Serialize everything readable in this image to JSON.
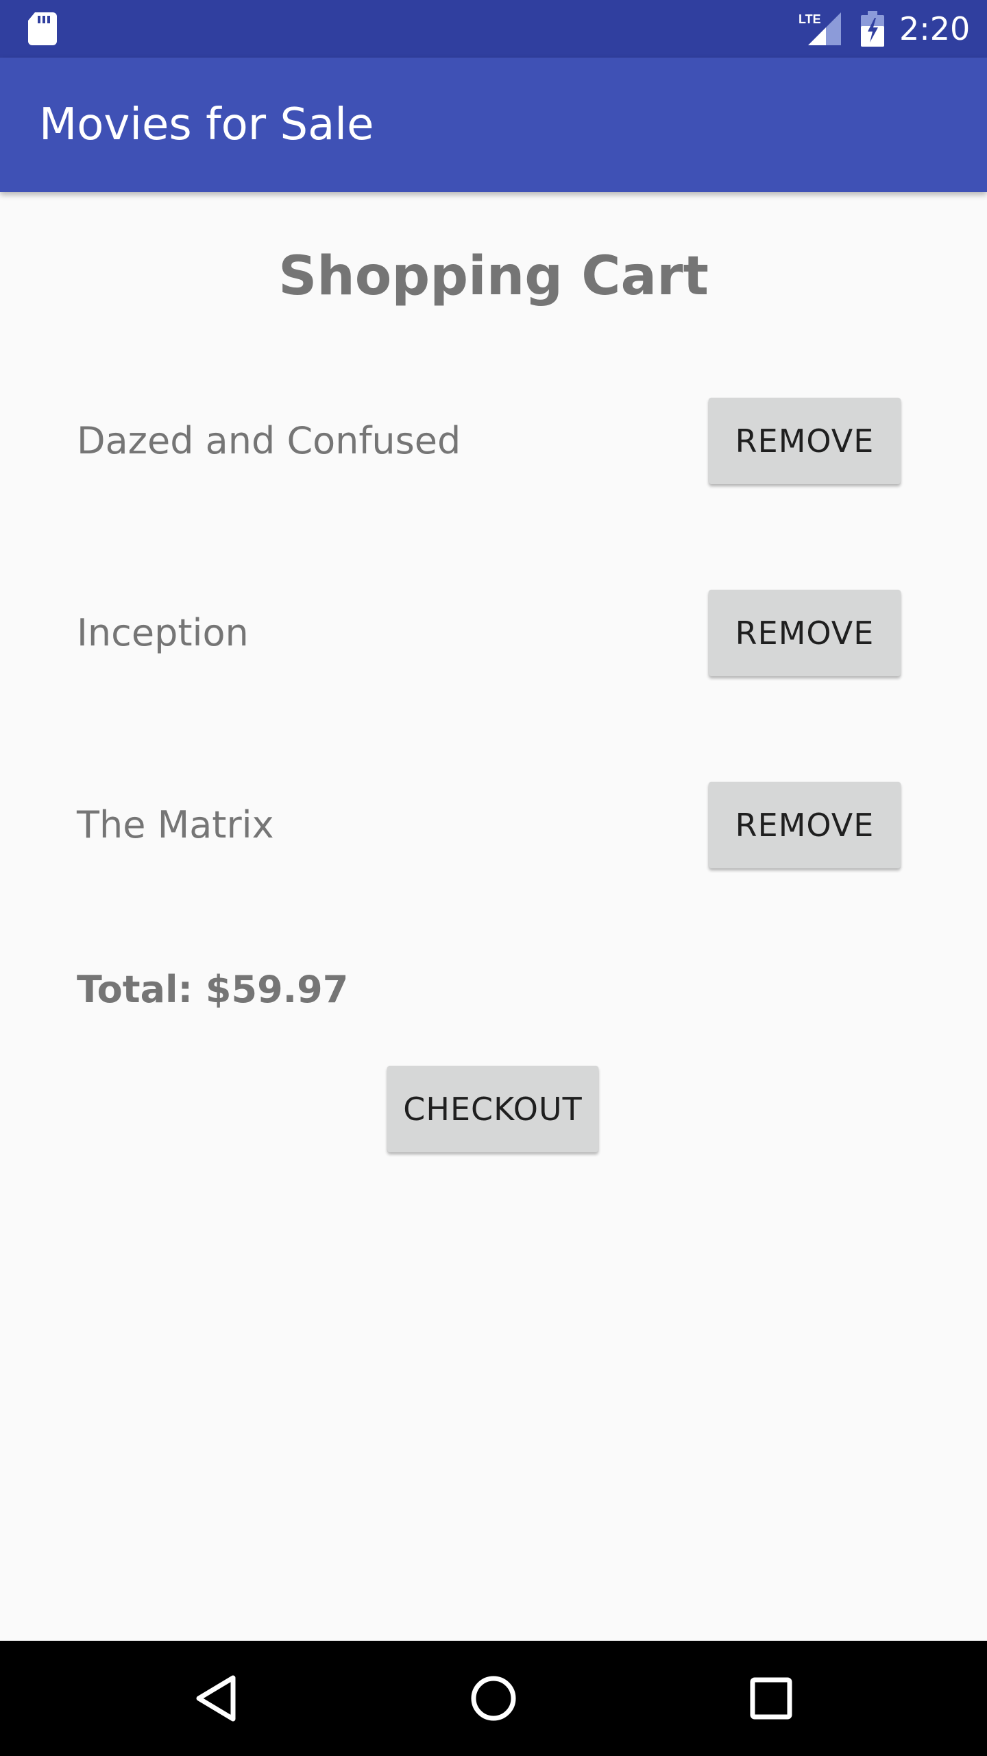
{
  "status_bar": {
    "time": "2:20",
    "network_label": "LTE",
    "icons": [
      "sd-card-icon",
      "lte-signal-icon",
      "battery-charging-icon"
    ]
  },
  "app_bar": {
    "title": "Movies for Sale"
  },
  "cart": {
    "title": "Shopping Cart",
    "items": [
      {
        "name": "Dazed and Confused",
        "remove_label": "REMOVE"
      },
      {
        "name": "Inception",
        "remove_label": "REMOVE"
      },
      {
        "name": "The Matrix",
        "remove_label": "REMOVE"
      }
    ],
    "total": "Total: $59.97",
    "checkout_label": "CHECKOUT"
  },
  "nav_bar": {
    "icons": [
      "back-icon",
      "home-icon",
      "recents-icon"
    ]
  },
  "colors": {
    "status_bar": "#303F9F",
    "app_bar": "#3F51B5",
    "background": "#FAFAFA",
    "button": "#D6D7D7",
    "text_secondary": "#757575"
  }
}
